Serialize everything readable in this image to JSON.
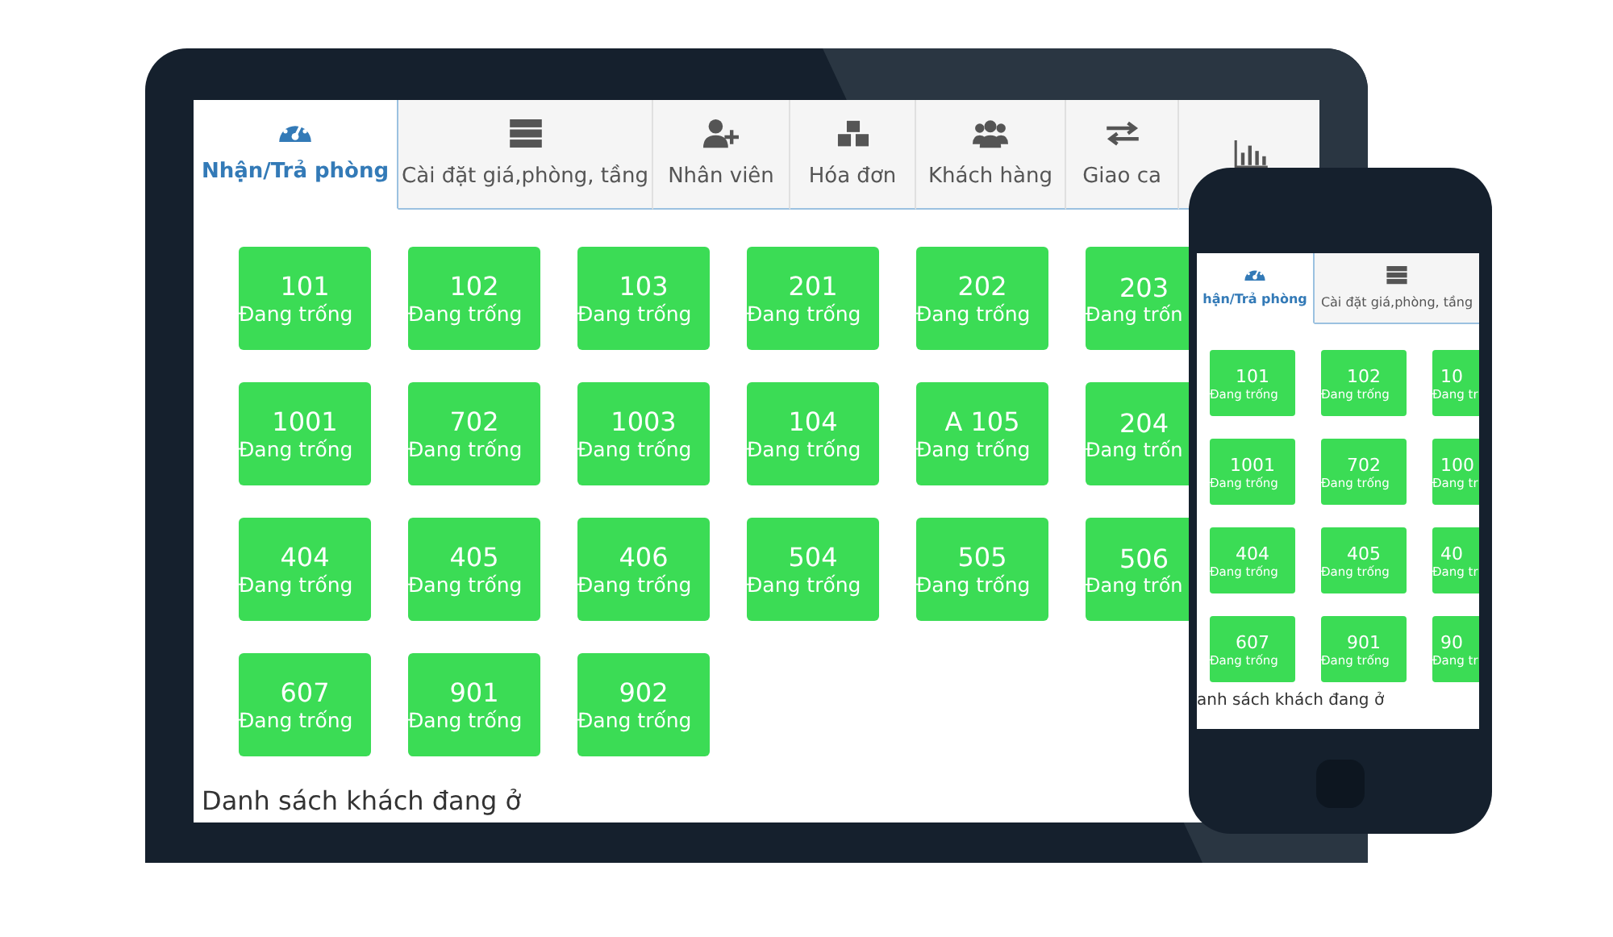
{
  "tablet": {
    "tabs": [
      {
        "label": "Nhận/Trả phòng",
        "kind": "dashboard",
        "selected": true
      },
      {
        "label": "Cài đặt giá,phòng, tầng",
        "kind": "server",
        "selected": false
      },
      {
        "label": "Nhân viên",
        "kind": "user-plus",
        "selected": false
      },
      {
        "label": "Hóa đơn",
        "kind": "cubes",
        "selected": false
      },
      {
        "label": "Khách hàng",
        "kind": "users",
        "selected": false
      },
      {
        "label": "Giao ca",
        "kind": "exchange",
        "selected": false
      },
      {
        "kind": "chart",
        "selected": false
      }
    ],
    "rooms": [
      {
        "number": "101",
        "status": "Đang trống"
      },
      {
        "number": "102",
        "status": "Đang trống"
      },
      {
        "number": "103",
        "status": "Đang trống"
      },
      {
        "number": "201",
        "status": "Đang trống"
      },
      {
        "number": "202",
        "status": "Đang trống"
      },
      {
        "number": "203",
        "status": "Đang trốn",
        "cut": true
      },
      {
        "number": "1001",
        "status": "Đang trống"
      },
      {
        "number": "702",
        "status": "Đang trống"
      },
      {
        "number": "1003",
        "status": "Đang trống"
      },
      {
        "number": "104",
        "status": "Đang trống"
      },
      {
        "number": "A 105",
        "status": "Đang trống"
      },
      {
        "number": "204",
        "status": "Đang trốn",
        "cut": true
      },
      {
        "number": "404",
        "status": "Đang trống"
      },
      {
        "number": "405",
        "status": "Đang trống"
      },
      {
        "number": "406",
        "status": "Đang trống"
      },
      {
        "number": "504",
        "status": "Đang trống"
      },
      {
        "number": "505",
        "status": "Đang trống"
      },
      {
        "number": "506",
        "status": "Đang trốn",
        "cut": true
      },
      {
        "number": "607",
        "status": "Đang trống"
      },
      {
        "number": "901",
        "status": "Đang trống"
      },
      {
        "number": "902",
        "status": "Đang trống"
      }
    ],
    "footer": "Danh sách khách đang ở"
  },
  "phone": {
    "tabs": [
      {
        "label": "hận/Trả phòng",
        "kind": "dashboard",
        "selected": true
      },
      {
        "label": "Cài đặt giá,phòng, tầng",
        "kind": "server",
        "selected": false
      }
    ],
    "rooms": [
      {
        "number": "101",
        "status": "Đang trống"
      },
      {
        "number": "102",
        "status": "Đang trống"
      },
      {
        "number": "10",
        "status": "Đang tr",
        "cut": true
      },
      {
        "number": "1001",
        "status": "Đang trống"
      },
      {
        "number": "702",
        "status": "Đang trống"
      },
      {
        "number": "100",
        "status": "Đang tr",
        "cut": true
      },
      {
        "number": "404",
        "status": "Đang trống"
      },
      {
        "number": "405",
        "status": "Đang trống"
      },
      {
        "number": "40",
        "status": "Đang tr",
        "cut": true
      },
      {
        "number": "607",
        "status": "Đang trống"
      },
      {
        "number": "901",
        "status": "Đang trống"
      },
      {
        "number": "90",
        "status": "Đang tr",
        "cut": true
      }
    ],
    "footer": "anh sách khách đang ở"
  }
}
